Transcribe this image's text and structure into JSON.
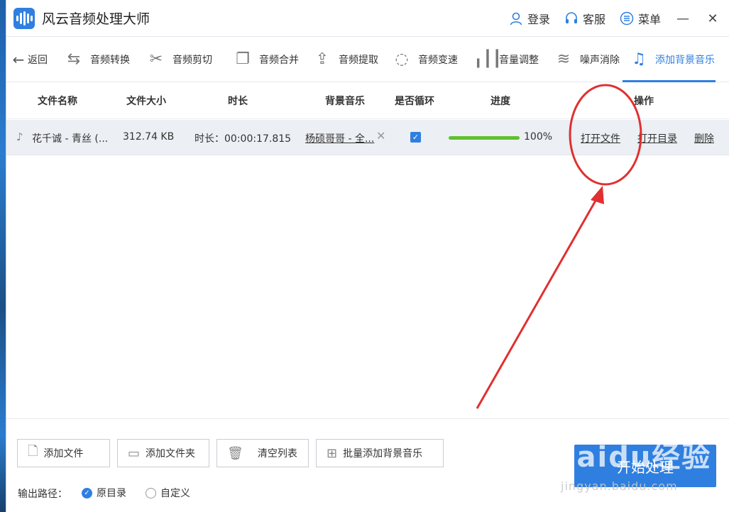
{
  "app": {
    "title": "风云音频处理大师"
  },
  "titlebar": {
    "login_label": "登录",
    "service_label": "客服",
    "menu_label": "菜单",
    "minimize_glyph": "—",
    "close_glyph": "✕"
  },
  "toolbar": {
    "back_label": "返回",
    "items": [
      {
        "label": "音频转换",
        "icon": "convert-icon"
      },
      {
        "label": "音频剪切",
        "icon": "scissors-icon"
      },
      {
        "label": "音频合并",
        "icon": "merge-icon"
      },
      {
        "label": "音频提取",
        "icon": "upload-icon"
      },
      {
        "label": "音频变速",
        "icon": "speed-icon"
      },
      {
        "label": "音量调整",
        "icon": "volume-bars-icon"
      },
      {
        "label": "噪声消除",
        "icon": "noise-icon"
      },
      {
        "label": "添加背景音乐",
        "icon": "music-note-icon",
        "active": true
      }
    ]
  },
  "table": {
    "headers": {
      "name": "文件名称",
      "size": "文件大小",
      "duration": "时长",
      "bgm": "背景音乐",
      "loop": "是否循环",
      "progress": "进度",
      "actions": "操作"
    },
    "rows": [
      {
        "name": "花千诚 - 青丝 (...",
        "size": "312.74 KB",
        "duration": "时长：00:00:17.815",
        "bgm": "杨硕哥哥 - 全...",
        "loop": true,
        "progress": 1.0,
        "progress_text": "100%",
        "open_file": "打开文件",
        "open_dir": "打开目录",
        "delete": "删除"
      }
    ]
  },
  "bottom": {
    "add_file": "添加文件",
    "add_folder": "添加文件夹",
    "clear_list": "清空列表",
    "batch_add_bgm": "批量添加背景音乐",
    "start": "开始处理",
    "output_label": "输出路径：",
    "radio_original": "原目录",
    "radio_custom": "自定义"
  },
  "watermark": {
    "main": "Baidu经验",
    "sub": "jingyan.baidu.com"
  },
  "colors": {
    "accent": "#2f7fe0",
    "progress": "#5fc12f",
    "annotation": "#e03030"
  }
}
